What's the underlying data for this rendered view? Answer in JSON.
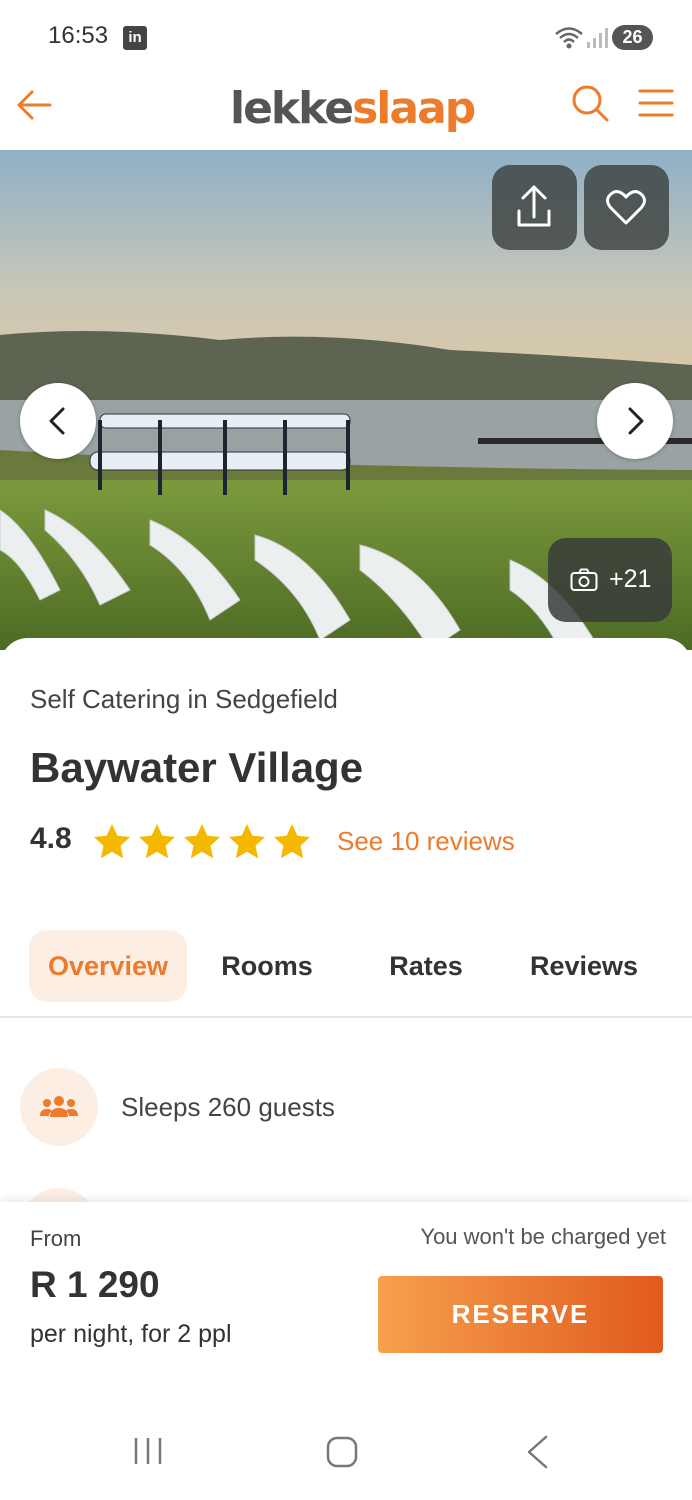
{
  "status_bar": {
    "time": "16:53",
    "notification_icon": "linkedin-icon",
    "notification_label": "in",
    "battery": "26"
  },
  "header": {
    "logo_part1": "lekke",
    "logo_part2": "slaap",
    "brand_color": "#ec7b2c"
  },
  "hero": {
    "photo_count": "+21"
  },
  "property": {
    "category": "Self Catering in Sedgefield",
    "name": "Baywater Village",
    "rating": "4.8",
    "stars": 5,
    "star_color": "#f5b800",
    "reviews_link": "See 10 reviews"
  },
  "tabs": [
    {
      "label": "Overview",
      "active": true
    },
    {
      "label": "Rooms",
      "active": false
    },
    {
      "label": "Rates",
      "active": false
    },
    {
      "label": "Reviews",
      "active": false
    }
  ],
  "features": [
    {
      "icon": "guests-icon",
      "text": "Sleeps 260 guests"
    }
  ],
  "booking": {
    "from_label": "From",
    "price": "R 1 290",
    "per_night": "per night, for 2 ppl",
    "charge_note": "You won't be charged yet",
    "reserve_label": "RESERVE"
  }
}
